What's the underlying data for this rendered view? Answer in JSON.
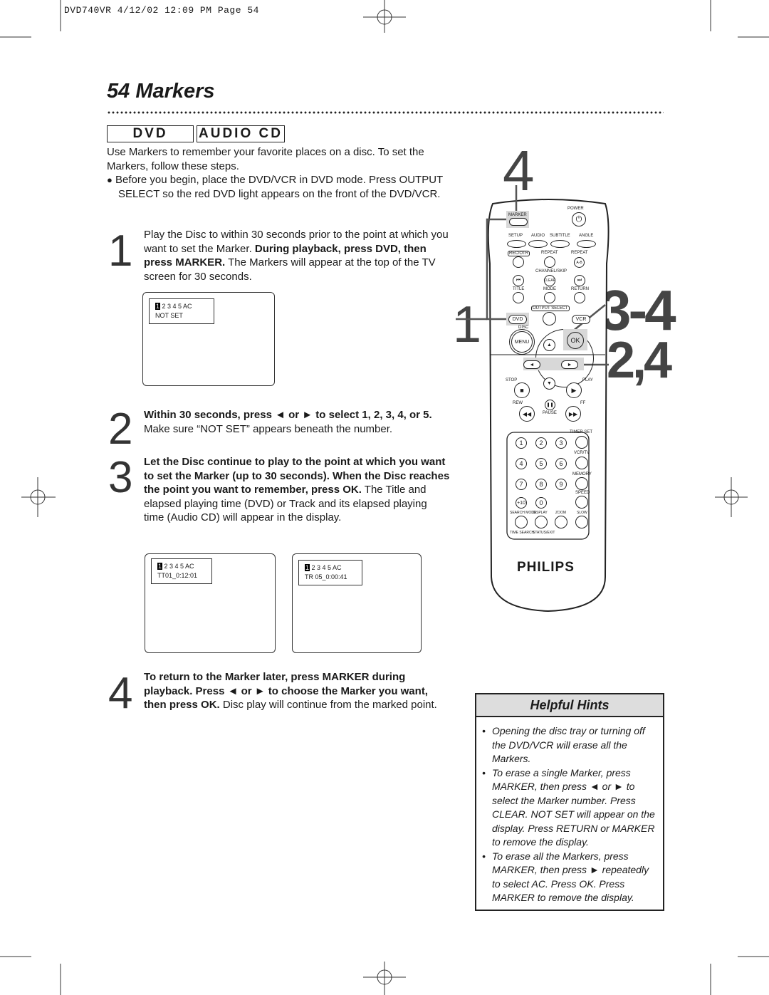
{
  "header": {
    "print_slug": "DVD740VR   4/12/02   12:09 PM   Page 54"
  },
  "title": "54  Markers",
  "tags": [
    "DVD",
    "AUDIO CD"
  ],
  "intro": "Use Markers to remember your favorite places on a disc. To set the Markers, follow these steps.",
  "before": "Before you begin, place the DVD/VCR in DVD mode. Press OUTPUT SELECT so the red DVD light appears on the front of the DVD/VCR.",
  "steps": [
    {
      "num": "1",
      "bold_a": "",
      "text_a": "Play the Disc to within 30 seconds prior to the point at which you want to set the Marker. ",
      "bold_b": "During playback, press DVD, then press MARKER.",
      "text_b": " The Markers will appear at the top of the TV screen for 30 seconds."
    },
    {
      "num": "2",
      "bold_a": "Within 30 seconds, press ◄ or ► to select 1, 2, 3, 4, or 5.",
      "text_a": " Make sure “NOT SET” appears beneath the number."
    },
    {
      "num": "3",
      "bold_a": "Let the Disc continue to play to the point at which you want to set the Marker (up to 30 seconds). When the Disc reaches the point you want to remember, press OK.",
      "text_a": " The Title and elapsed playing time (DVD) or Track and its elapsed playing time (Audio CD) will appear in the display."
    },
    {
      "num": "4",
      "bold_a": "To return to the Marker later, press MARKER during playback. Press ◄ or ► to choose the Marker you want, then press OK.",
      "text_a": " Disc play will continue from the marked point."
    }
  ],
  "screens": [
    {
      "selected": "1",
      "markers": " 2 3 4 5 AC",
      "line2": "NOT SET"
    },
    {
      "selected": "1",
      "markers": " 2 3 4 5 AC",
      "line2": "TT01_0:12:01"
    },
    {
      "selected": "1",
      "markers": " 2 3 4 5 AC",
      "line2": "TR 05_0:00:41"
    }
  ],
  "callouts": {
    "c4": "4",
    "c1": "1",
    "c34": "3-4",
    "c24": "2,4"
  },
  "remote": {
    "power": "POWER",
    "marker": "MARKER",
    "setup": "SETUP",
    "audio": "AUDIO",
    "subtitle": "SUBTITLE",
    "angle": "ANGLE",
    "rec_otr": "REC/OTR",
    "repeat": "REPEAT",
    "repeat2": "REPEAT",
    "ab": "A-B",
    "channel_skip": "CHANNEL/SKIP",
    "clear": "CLEAR",
    "title": "TITLE",
    "mode": "MODE",
    "return": "RETURN",
    "output_select": "OUTPUT SELECT",
    "dvd": "DVD",
    "vcr": "VCR",
    "disc": "DISC",
    "menu": "MENU",
    "ok": "OK",
    "stop": "STOP",
    "play": "PLAY",
    "rew": "REW",
    "ff": "FF",
    "pause": "PAUSE",
    "timer_set": "TIMER SET",
    "vcr_tv": "VCR/TV",
    "memory": "MEMORY",
    "speed": "SPEED",
    "digits": [
      "1",
      "2",
      "3",
      "4",
      "5",
      "6",
      "7",
      "8",
      "9",
      "+10",
      "0"
    ],
    "search_mode": "SEARCH MODE",
    "display": "DISPLAY",
    "zoom": "ZOOM",
    "slow": "SLOW",
    "time_search": "TIME SEARCH",
    "status_exit": "STATUS/EXIT",
    "brand": "PHILIPS"
  },
  "hints": {
    "title": "Helpful Hints",
    "items": [
      "Opening the disc tray or turning off the DVD/VCR will erase all the Markers.",
      "To erase a single Marker, press MARKER, then press ◄ or ► to select the Marker number. Press CLEAR. NOT SET will appear on the display. Press RETURN or MARKER to remove the display.",
      "To erase all the Markers, press MARKER, then press ► repeatedly to select AC. Press OK. Press MARKER to remove the display."
    ]
  }
}
